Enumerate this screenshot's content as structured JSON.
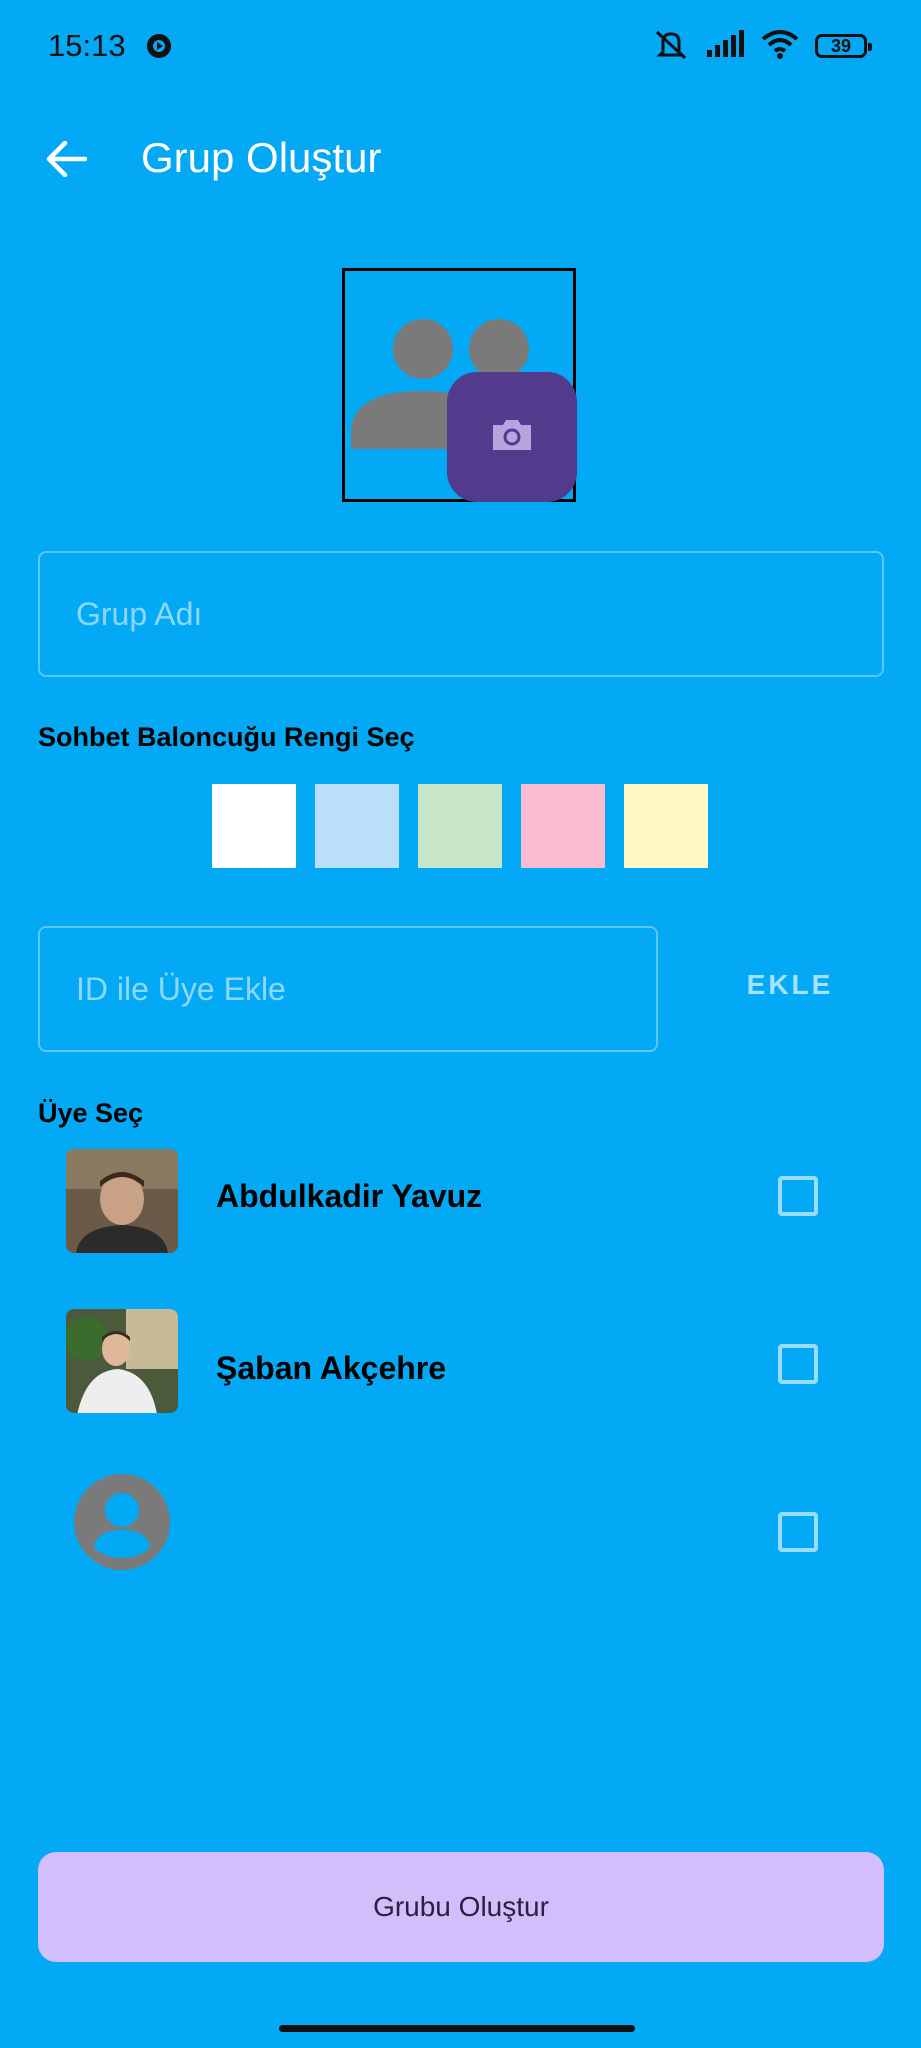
{
  "status_bar": {
    "time": "15:13",
    "battery": "39"
  },
  "app_bar": {
    "title": "Grup Oluştur"
  },
  "form": {
    "group_name_placeholder": "Grup Adı",
    "bubble_color_label": "Sohbet Baloncuğu Rengi Seç",
    "bubble_colors": [
      "#FFFFFF",
      "#BBDEFB",
      "#C8E6C9",
      "#F8BBD0",
      "#FFF9C4"
    ],
    "member_id_placeholder": "ID ile Üye Ekle",
    "add_button_label": "EKLE",
    "select_members_label": "Üye Seç"
  },
  "members": [
    {
      "name": "Abdulkadir Yavuz",
      "checked": false
    },
    {
      "name": "Şaban Akçehre",
      "checked": false
    },
    {
      "name": "",
      "checked": false
    }
  ],
  "create_button_label": "Grubu Oluştur",
  "colors": {
    "background": "#03A9F4",
    "camera_button": "#523A8C",
    "create_button": "#D3BDFB"
  }
}
